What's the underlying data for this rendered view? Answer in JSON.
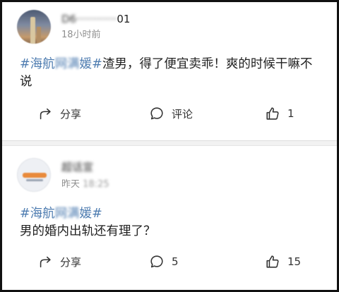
{
  "posts": [
    {
      "username_prefix": "D6············",
      "username_suffix": "01",
      "time": "18小时前",
      "hashtag_open": "#海航",
      "hashtag_blurred": "网满",
      "hashtag_close": "媛#",
      "content_text": "渣男，得了便宜卖乖！爽的时候干嘛不说",
      "share_label": "分享",
      "comment_label": "评论",
      "like_count": "1"
    },
    {
      "username_blurred": "超话宣",
      "time": "昨天",
      "time_blurred": "18:25",
      "hashtag_open": "#海航",
      "hashtag_blurred": "网满",
      "hashtag_close": "媛#",
      "content_text": "男的婚内出轨还有理了？",
      "share_label": "分享",
      "comment_count": "5",
      "like_count": "15"
    }
  ],
  "icons": {
    "share": "share-arrow-icon",
    "comment": "comment-bubble-icon",
    "like": "thumbs-up-icon"
  },
  "colors": {
    "hashtag": "#4f7db1",
    "time": "#8f8f8f",
    "text": "#222222"
  }
}
